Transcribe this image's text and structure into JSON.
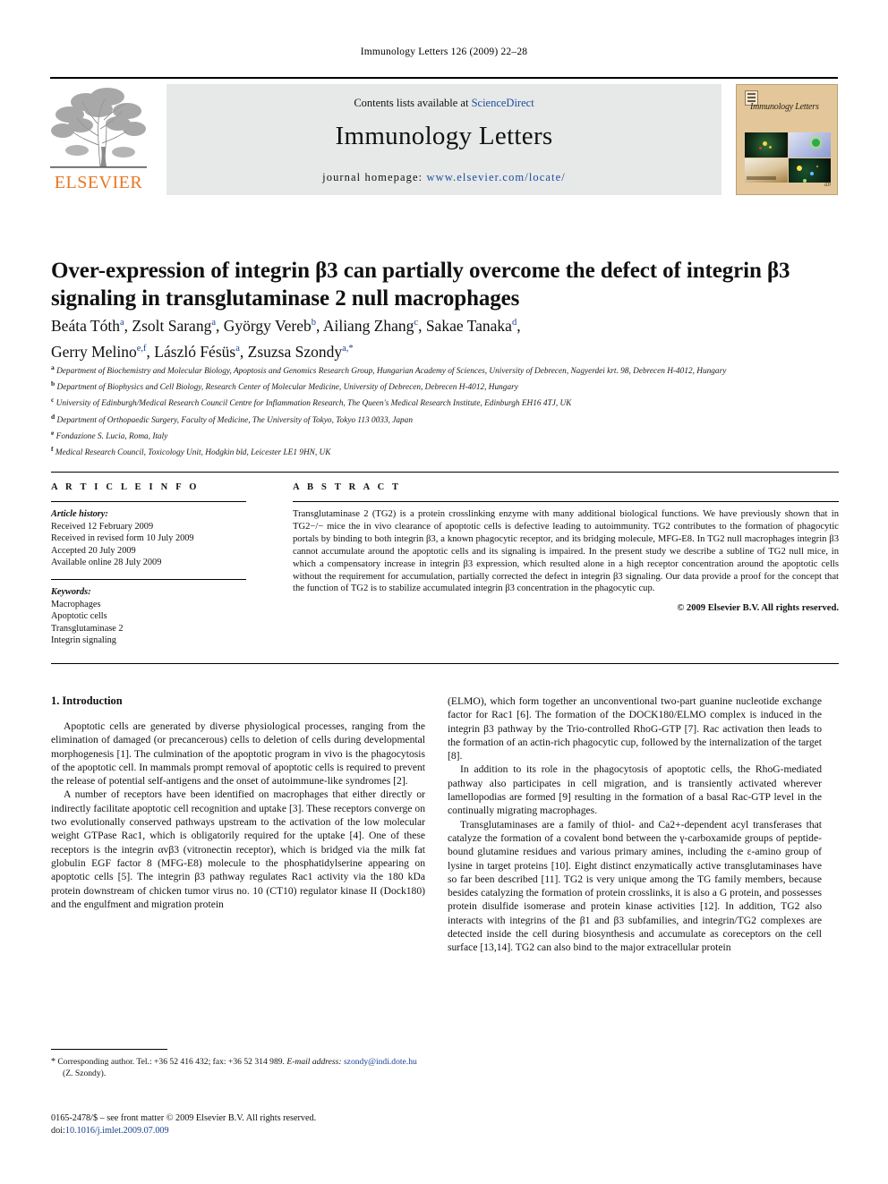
{
  "running_head": "Immunology Letters 126 (2009) 22–28",
  "masthead": {
    "contents_prefix": "Contents lists available at ",
    "sciencedirect": "ScienceDirect",
    "journal_title": "Immunology Letters",
    "homepage_prefix": "journal homepage: ",
    "homepage_url": "www.elsevier.com/locate/",
    "publisher_name": "ELSEVIER",
    "publisher_color": "#E87722",
    "link_color": "#1a4fa0",
    "cover_journal_name": "Immunology Letters",
    "cover_bg_color": "#e3c79a"
  },
  "article": {
    "title": "Over-expression of integrin β3 can partially overcome the defect of integrin β3 signaling in transglutaminase 2 null macrophages",
    "authors_line_1": "Beáta Tóth ᵃ, Zsolt Sarang ᵃ, György Vereb ᵇ, Ailiang Zhang ᶜ, Sakae Tanaka ᵈ,",
    "authors_line_2": "Gerry Melino ᵉ,ᶠ, László Fésüs ᵃ, Zsuzsa Szondy ᵃ,*",
    "authors": [
      {
        "name": "Beáta Tóth",
        "sup": "a"
      },
      {
        "name": "Zsolt Sarang",
        "sup": "a"
      },
      {
        "name": "György Vereb",
        "sup": "b"
      },
      {
        "name": "Ailiang Zhang",
        "sup": "c"
      },
      {
        "name": "Sakae Tanaka",
        "sup": "d"
      },
      {
        "name": "Gerry Melino",
        "sup": "e,f"
      },
      {
        "name": "László Fésüs",
        "sup": "a"
      },
      {
        "name": "Zsuzsa Szondy",
        "sup": "a,*"
      }
    ],
    "affiliations": [
      {
        "mark": "a",
        "text": "Department of Biochemistry and Molecular Biology, Apoptosis and Genomics Research Group, Hungarian Academy of Sciences, University of Debrecen, Nagyerdei krt. 98, Debrecen H-4012, Hungary"
      },
      {
        "mark": "b",
        "text": "Department of Biophysics and Cell Biology, Research Center of Molecular Medicine, University of Debrecen, Debrecen H-4012, Hungary"
      },
      {
        "mark": "c",
        "text": "University of Edinburgh/Medical Research Council Centre for Inflammation Research, The Queen's Medical Research Institute, Edinburgh EH16 4TJ, UK"
      },
      {
        "mark": "d",
        "text": "Department of Orthopaedic Surgery, Faculty of Medicine, The University of Tokyo, Tokyo 113 0033, Japan"
      },
      {
        "mark": "e",
        "text": "Fondazione S. Lucia, Roma, Italy"
      },
      {
        "mark": "f",
        "text": "Medical Research Council, Toxicology Unit, Hodgkin bld, Leicester LE1 9HN, UK"
      }
    ]
  },
  "article_info": {
    "heading": "A R T I C L E    I N F O",
    "history_label": "Article history:",
    "history": [
      "Received 12 February 2009",
      "Received in revised form 10 July 2009",
      "Accepted 20 July 2009",
      "Available online 28 July 2009"
    ],
    "keywords_label": "Keywords:",
    "keywords": [
      "Macrophages",
      "Apoptotic cells",
      "Transglutaminase 2",
      "Integrin signaling"
    ]
  },
  "abstract": {
    "heading": "A B S T R A C T",
    "text": "Transglutaminase 2 (TG2) is a protein crosslinking enzyme with many additional biological functions. We have previously shown that in TG2−/− mice the in vivo clearance of apoptotic cells is defective leading to autoimmunity. TG2 contributes to the formation of phagocytic portals by binding to both integrin β3, a known phagocytic receptor, and its bridging molecule, MFG-E8. In TG2 null macrophages integrin β3 cannot accumulate around the apoptotic cells and its signaling is impaired. In the present study we describe a subline of TG2 null mice, in which a compensatory increase in integrin β3 expression, which resulted alone in a high receptor concentration around the apoptotic cells without the requirement for accumulation, partially corrected the defect in integrin β3 signaling. Our data provide a proof for the concept that the function of TG2 is to stabilize accumulated integrin β3 concentration in the phagocytic cup.",
    "copyright": "© 2009 Elsevier B.V. All rights reserved."
  },
  "body": {
    "section_title": "1. Introduction",
    "left_paragraphs": [
      "Apoptotic cells are generated by diverse physiological processes, ranging from the elimination of damaged (or precancerous) cells to deletion of cells during developmental morphogenesis [1]. The culmination of the apoptotic program in vivo is the phagocytosis of the apoptotic cell. In mammals prompt removal of apoptotic cells is required to prevent the release of potential self-antigens and the onset of autoimmune-like syndromes [2].",
      "A number of receptors have been identified on macrophages that either directly or indirectly facilitate apoptotic cell recognition and uptake [3]. These receptors converge on two evolutionally conserved pathways upstream to the activation of the low molecular weight GTPase Rac1, which is obligatorily required for the uptake [4]. One of these receptors is the integrin αvβ3 (vitronectin receptor), which is bridged via the milk fat globulin EGF factor 8 (MFG-E8) molecule to the phosphatidylserine appearing on apoptotic cells [5]. The integrin β3 pathway regulates Rac1 activity via the 180 kDa protein downstream of chicken tumor virus no. 10 (CT10) regulator kinase II (Dock180) and the engulfment and migration protein"
    ],
    "right_paragraphs": [
      "(ELMO), which form together an unconventional two-part guanine nucleotide exchange factor for Rac1 [6]. The formation of the DOCK180/ELMO complex is induced in the integrin β3 pathway by the Trio-controlled RhoG-GTP [7]. Rac activation then leads to the formation of an actin-rich phagocytic cup, followed by the internalization of the target [8].",
      "In addition to its role in the phagocytosis of apoptotic cells, the RhoG-mediated pathway also participates in cell migration, and is transiently activated wherever lamellopodias are formed [9] resulting in the formation of a basal Rac-GTP level in the continually migrating macrophages.",
      "Transglutaminases are a family of thiol- and Ca2+-dependent acyl transferases that catalyze the formation of a covalent bond between the γ-carboxamide groups of peptide-bound glutamine residues and various primary amines, including the ε-amino group of lysine in target proteins [10]. Eight distinct enzymatically active transglutaminases have so far been described [11]. TG2 is very unique among the TG family members, because besides catalyzing the formation of protein crosslinks, it is also a G protein, and possesses protein disulfide isomerase and protein kinase activities [12]. In addition, TG2 also interacts with integrins of the β1 and β3 subfamilies, and integrin/TG2 complexes are detected inside the cell during biosynthesis and accumulate as coreceptors on the cell surface [13,14]. TG2 can also bind to the major extracellular protein"
    ]
  },
  "footnote": {
    "marker": "*",
    "corresponding": "Corresponding author. Tel.: +36 52 416 432; fax: +36 52 314 989.",
    "email_label": "E-mail address:",
    "email": "szondy@indi.dote.hu",
    "email_owner": "(Z. Szondy)."
  },
  "footer": {
    "issn_line": "0165-2478/$ – see front matter © 2009 Elsevier B.V. All rights reserved.",
    "doi_label": "doi:",
    "doi": "10.1016/j.imlet.2009.07.009"
  }
}
